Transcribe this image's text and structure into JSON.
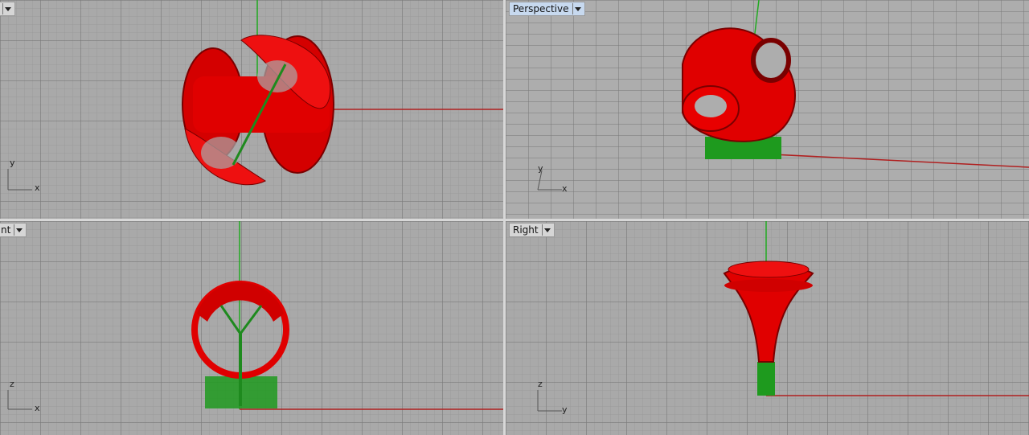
{
  "viewports": {
    "top": {
      "label": ""
    },
    "perspective": {
      "label": "Perspective"
    },
    "front": {
      "label": "nt"
    },
    "right": {
      "label": "Right"
    }
  },
  "axes": {
    "top": {
      "vertical": "y",
      "horizontal": "x"
    },
    "perspective": {
      "vertical": "y",
      "horizontal": "x"
    },
    "front": {
      "vertical": "z",
      "horizontal": "x"
    },
    "right": {
      "vertical": "z",
      "horizontal": "y"
    }
  },
  "colors": {
    "model": "#e00000",
    "model_dark": "#8a0000",
    "support": "#1e9a1e",
    "x_axis": "#b02020",
    "y_axis": "#22aa22",
    "active_label": "#c7d9ef"
  }
}
